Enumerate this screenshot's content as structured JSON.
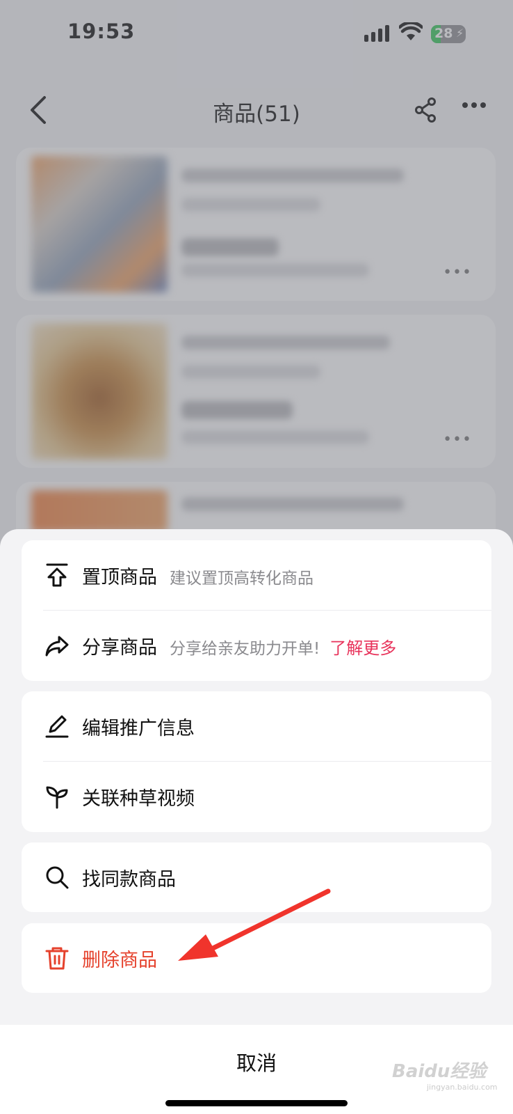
{
  "status": {
    "time": "19:53",
    "battery": "28"
  },
  "nav": {
    "title": "商品(51)"
  },
  "actions": {
    "pin": {
      "label": "置顶商品",
      "hint": "建议置顶高转化商品"
    },
    "share": {
      "label": "分享商品",
      "hint": "分享给亲友助力开单!",
      "link": "了解更多"
    },
    "edit": {
      "label": "编辑推广信息"
    },
    "link_video": {
      "label": "关联种草视频"
    },
    "find_same": {
      "label": "找同款商品"
    },
    "delete": {
      "label": "删除商品"
    },
    "cancel": "取消"
  },
  "accent_colors": {
    "danger": "#e5412c",
    "link": "#e8335b",
    "annotation_arrow": "#f0342c"
  },
  "icons": [
    "chevron-left-icon",
    "share-icon",
    "more-icon",
    "pin-top-icon",
    "share-arrow-icon",
    "pencil-icon",
    "sprout-icon",
    "search-icon",
    "trash-icon"
  ],
  "watermark": {
    "brand": "Baidu经验",
    "url": "jingyan.baidu.com"
  }
}
